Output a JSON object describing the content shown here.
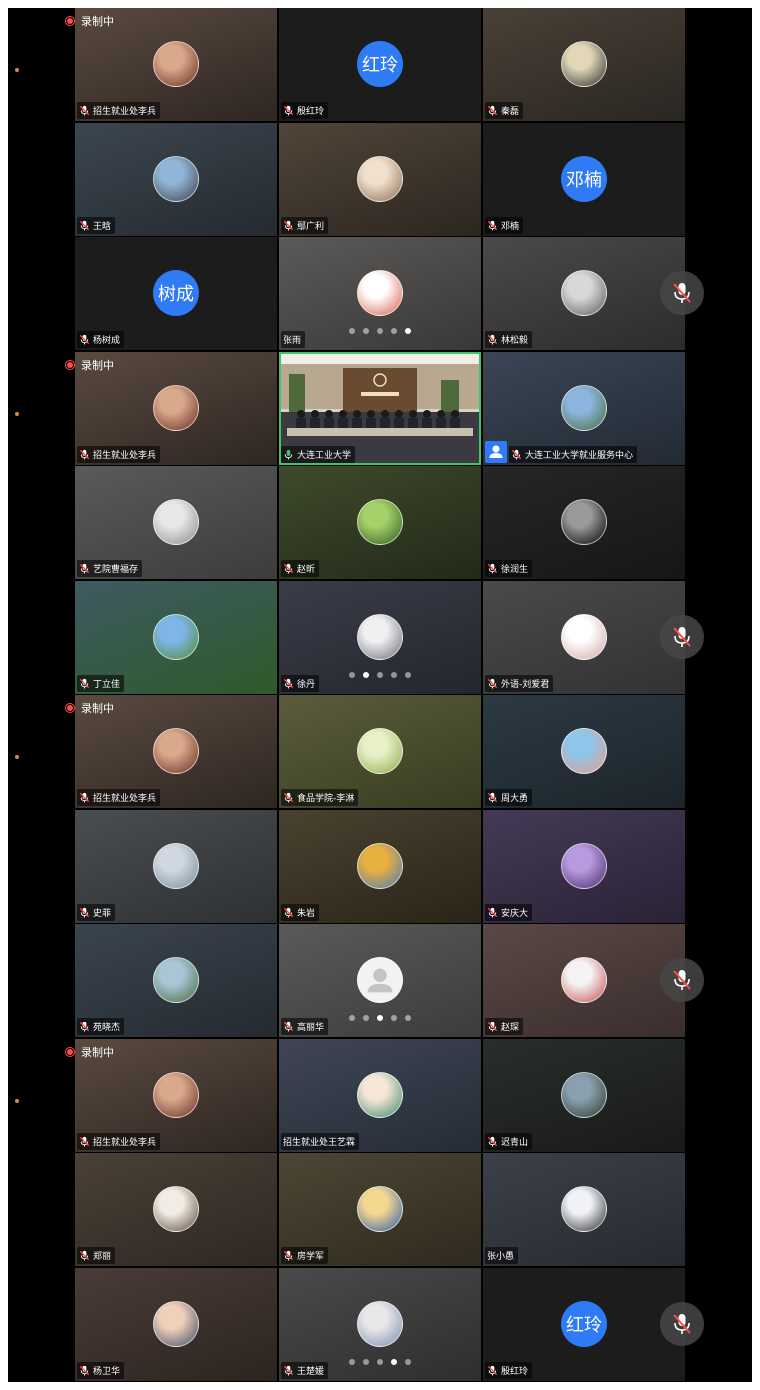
{
  "indicators": {
    "recording_label": "录制中"
  },
  "colors": {
    "accent_blue": "#2f7bf6",
    "active_border": "#3ec46a",
    "recording": "#ff4d4d",
    "side_dot": "#e0862e"
  },
  "rows": [
    {
      "tiles": [
        {
          "name": "招生就业处李兵",
          "avatar": "photo",
          "bg": [
            "#5a4a40",
            "#2e2621"
          ],
          "ac": [
            "#d9a98c",
            "#6a2a22"
          ],
          "muted_icon": true,
          "rec": true
        },
        {
          "name": "殷红玲",
          "avatar": "text",
          "avatar_text": "红玲",
          "bg": [
            "#1c1c1c",
            "#1c1c1c"
          ],
          "muted_icon": true
        },
        {
          "name": "秦磊",
          "avatar": "photo",
          "bg": [
            "#4a4036",
            "#2a2622"
          ],
          "ac": [
            "#e2d8b8",
            "#2a2a2a"
          ],
          "muted_icon": true
        }
      ]
    },
    {
      "tiles": [
        {
          "name": "王晗",
          "avatar": "photo",
          "bg": [
            "#3c4650",
            "#242a30"
          ],
          "ac": [
            "#8fb6d6",
            "#3e4048"
          ],
          "muted_icon": true
        },
        {
          "name": "鄢广利",
          "avatar": "photo",
          "bg": [
            "#504538",
            "#2c2620"
          ],
          "ac": [
            "#f2e0cc",
            "#8a6a52"
          ],
          "muted_icon": true
        },
        {
          "name": "邓楠",
          "avatar": "text",
          "avatar_text": "邓楠",
          "bg": [
            "#1c1c1c",
            "#1c1c1c"
          ],
          "muted_icon": true
        }
      ]
    },
    {
      "tiles": [
        {
          "name": "杨树成",
          "avatar": "text",
          "avatar_text": "树成",
          "bg": [
            "#1c1c1c",
            "#1c1c1c"
          ],
          "muted_icon": true
        },
        {
          "name": "张雨",
          "avatar": "photo",
          "bg": [
            "#5c5a58",
            "#3a3836"
          ],
          "ac": [
            "#ffffff",
            "#d85a4a"
          ],
          "muted_icon": false,
          "dots": 4
        },
        {
          "name": "林松毅",
          "avatar": "photo",
          "bg": [
            "#4c4a48",
            "#2e2c2a"
          ],
          "ac": [
            "#d8d8d8",
            "#5a5a5a"
          ],
          "muted_icon": true
        }
      ],
      "mute_btn": true
    },
    {
      "tiles": [
        {
          "name": "招生就业处李兵",
          "avatar": "photo",
          "bg": [
            "#5a4a40",
            "#2e2621"
          ],
          "ac": [
            "#d9a98c",
            "#6a2a22"
          ],
          "muted_icon": true,
          "rec": true
        },
        {
          "name": "大连工业大学",
          "avatar": "meeting",
          "bg": [
            "#6a6458",
            "#3a3630"
          ],
          "muted_icon": false,
          "active": true
        },
        {
          "name": "大连工业大学就业服务中心",
          "avatar": "photo",
          "bg": [
            "#3a4656",
            "#222a34"
          ],
          "ac": [
            "#8cb6e0",
            "#4a6a3a"
          ],
          "muted_icon": true,
          "user_badge": true
        }
      ]
    },
    {
      "tiles": [
        {
          "name": "艺院曹福存",
          "avatar": "photo",
          "bg": [
            "#5a5a5a",
            "#3c3c3c"
          ],
          "ac": [
            "#e8e8e8",
            "#8a8a8a"
          ],
          "muted_icon": true
        },
        {
          "name": "赵昕",
          "avatar": "photo",
          "bg": [
            "#3e4a2c",
            "#222a18"
          ],
          "ac": [
            "#a6d06a",
            "#2e5a1e"
          ],
          "muted_icon": true
        },
        {
          "name": "徐润生",
          "avatar": "photo",
          "bg": [
            "#262626",
            "#161616"
          ],
          "ac": [
            "#9a9a9a",
            "#000000"
          ],
          "muted_icon": true
        }
      ]
    },
    {
      "tiles": [
        {
          "name": "丁立佳",
          "avatar": "photo",
          "bg": [
            "#3e5a62",
            "#2e5a2a"
          ],
          "ac": [
            "#7fb6ea",
            "#4e8a2a"
          ],
          "muted_icon": true
        },
        {
          "name": "徐丹",
          "avatar": "photo",
          "bg": [
            "#3a3d48",
            "#24262e"
          ],
          "ac": [
            "#f0f0f0",
            "#6a6a76"
          ],
          "muted_icon": true,
          "dots": 1
        },
        {
          "name": "外语-刘爱君",
          "avatar": "photo",
          "bg": [
            "#4a4a4a",
            "#323232"
          ],
          "ac": [
            "#ffffff",
            "#cfa6a0"
          ],
          "muted_icon": true
        }
      ],
      "mute_btn": true
    },
    {
      "tiles": [
        {
          "name": "招生就业处李兵",
          "avatar": "photo",
          "bg": [
            "#5a4a40",
            "#2e2621"
          ],
          "ac": [
            "#d9a98c",
            "#6a2a22"
          ],
          "muted_icon": true,
          "rec": true
        },
        {
          "name": "食品学院-李淋",
          "avatar": "photo",
          "bg": [
            "#5a5c3c",
            "#3a3c22"
          ],
          "ac": [
            "#e8f0c8",
            "#8aaa4a"
          ],
          "muted_icon": true
        },
        {
          "name": "周大勇",
          "avatar": "photo",
          "bg": [
            "#2c3a44",
            "#1c242a"
          ],
          "ac": [
            "#8ec6ea",
            "#e89a8a"
          ],
          "muted_icon": true
        }
      ]
    },
    {
      "tiles": [
        {
          "name": "史菲",
          "avatar": "photo",
          "bg": [
            "#4a4e50",
            "#2e3032"
          ],
          "ac": [
            "#cfd8e0",
            "#7a8a96"
          ],
          "muted_icon": true
        },
        {
          "name": "朱岩",
          "avatar": "photo",
          "bg": [
            "#4a4230",
            "#2a2418"
          ],
          "ac": [
            "#e8b040",
            "#4a7aba"
          ],
          "muted_icon": true
        },
        {
          "name": "安庆大",
          "avatar": "photo",
          "bg": [
            "#443a56",
            "#2a2236"
          ],
          "ac": [
            "#b89ade",
            "#4a2a6a"
          ],
          "muted_icon": true
        }
      ]
    },
    {
      "tiles": [
        {
          "name": "苑晓杰",
          "avatar": "photo",
          "bg": [
            "#3a4450",
            "#242a30"
          ],
          "ac": [
            "#a8c6d8",
            "#4a6a3a"
          ],
          "muted_icon": true
        },
        {
          "name": "高丽华",
          "avatar": "default",
          "bg": [
            "#5a5a5a",
            "#3c3c3c"
          ],
          "muted_icon": true,
          "dots": 2
        },
        {
          "name": "赵琛",
          "avatar": "photo",
          "bg": [
            "#5a4846",
            "#3a2e2c"
          ],
          "ac": [
            "#f4f4f4",
            "#c84a4a"
          ],
          "muted_icon": true
        }
      ],
      "mute_btn": true
    },
    {
      "tiles": [
        {
          "name": "招生就业处李兵",
          "avatar": "photo",
          "bg": [
            "#5a4a40",
            "#2e2621"
          ],
          "ac": [
            "#d9a98c",
            "#6a2a22"
          ],
          "muted_icon": true,
          "rec": true
        },
        {
          "name": "招生就业处王艺霖",
          "avatar": "photo",
          "bg": [
            "#3e4656",
            "#262c36"
          ],
          "ac": [
            "#f6e6d6",
            "#3a8a6a"
          ],
          "muted_icon": false
        },
        {
          "name": "迟青山",
          "avatar": "photo",
          "bg": [
            "#2a2e2a",
            "#181a18"
          ],
          "ac": [
            "#8aa0b0",
            "#2e3a2a"
          ],
          "muted_icon": true
        }
      ]
    },
    {
      "tiles": [
        {
          "name": "郑丽",
          "avatar": "photo",
          "bg": [
            "#4a4036",
            "#2e2822"
          ],
          "ac": [
            "#f2ede4",
            "#5a4a3a"
          ],
          "muted_icon": true
        },
        {
          "name": "房学军",
          "avatar": "photo",
          "bg": [
            "#4e4634",
            "#2e2a1e"
          ],
          "ac": [
            "#f4d890",
            "#2a5aa8"
          ],
          "muted_icon": true
        },
        {
          "name": "张小愚",
          "avatar": "photo",
          "bg": [
            "#3c4048",
            "#262a30"
          ],
          "ac": [
            "#f0f2f6",
            "#2a2a2a"
          ],
          "muted_icon": false
        }
      ]
    },
    {
      "tiles": [
        {
          "name": "杨卫华",
          "avatar": "photo",
          "bg": [
            "#4a3c36",
            "#2c2420"
          ],
          "ac": [
            "#f0d0b8",
            "#3a4a6a"
          ],
          "muted_icon": true
        },
        {
          "name": "王楚媛",
          "avatar": "photo",
          "bg": [
            "#4a4a4a",
            "#2e2e2e"
          ],
          "ac": [
            "#e8e8e8",
            "#7a8ab0"
          ],
          "muted_icon": true,
          "dots": 3
        },
        {
          "name": "殷红玲",
          "avatar": "text",
          "avatar_text": "红玲",
          "bg": [
            "#1c1c1c",
            "#1c1c1c"
          ],
          "muted_icon": true
        }
      ],
      "mute_btn": true
    }
  ]
}
